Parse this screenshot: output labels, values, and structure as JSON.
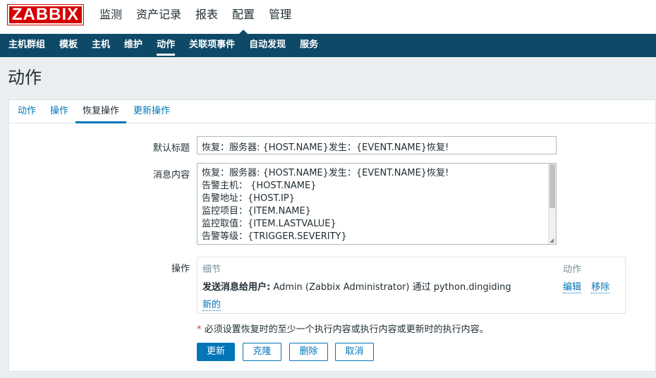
{
  "header": {
    "logo": "ZABBIX",
    "menu": [
      "监测",
      "资产记录",
      "报表",
      "配置",
      "管理"
    ],
    "active_index": 3
  },
  "submenu": {
    "items": [
      "主机群组",
      "模板",
      "主机",
      "维护",
      "动作",
      "关联项事件",
      "自动发现",
      "服务"
    ],
    "active_index": 4
  },
  "page": {
    "title": "动作"
  },
  "tabs": {
    "items": [
      "动作",
      "操作",
      "恢复操作",
      "更新操作"
    ],
    "active_index": 2
  },
  "form": {
    "default_subject_label": "默认标题",
    "default_subject_value": "恢复：服务器: {HOST.NAME}发生：{EVENT.NAME}恢复!",
    "message_label": "消息内容",
    "message_lines": [
      "恢复：服务器: {HOST.NAME}发生：{EVENT.NAME}恢复!",
      "告警主机：  {HOST.NAME}",
      "告警地址：{HOST.IP}",
      "监控项目：{ITEM.NAME}",
      "监控取值：{ITEM.LASTVALUE}",
      "告警等级：{TRIGGER.SEVERITY}"
    ],
    "operations_label": "操作",
    "operations": {
      "col_details": "细节",
      "col_action": "动作",
      "row_bold": "发送消息给用户:",
      "row_text": " Admin (Zabbix Administrator) 通过 python.dingiding",
      "edit": "编辑",
      "remove": "移除",
      "new": "新的"
    },
    "note_star": "*",
    "note": " 必须设置恢复时的至少一个执行内容或执行内容或更新时的执行内容。"
  },
  "buttons": {
    "update": "更新",
    "clone": "克隆",
    "delete": "删除",
    "cancel": "取消"
  },
  "colors": {
    "brand_red": "#d40000",
    "nav_blue": "#0e4a68",
    "link_blue": "#0275b8"
  }
}
